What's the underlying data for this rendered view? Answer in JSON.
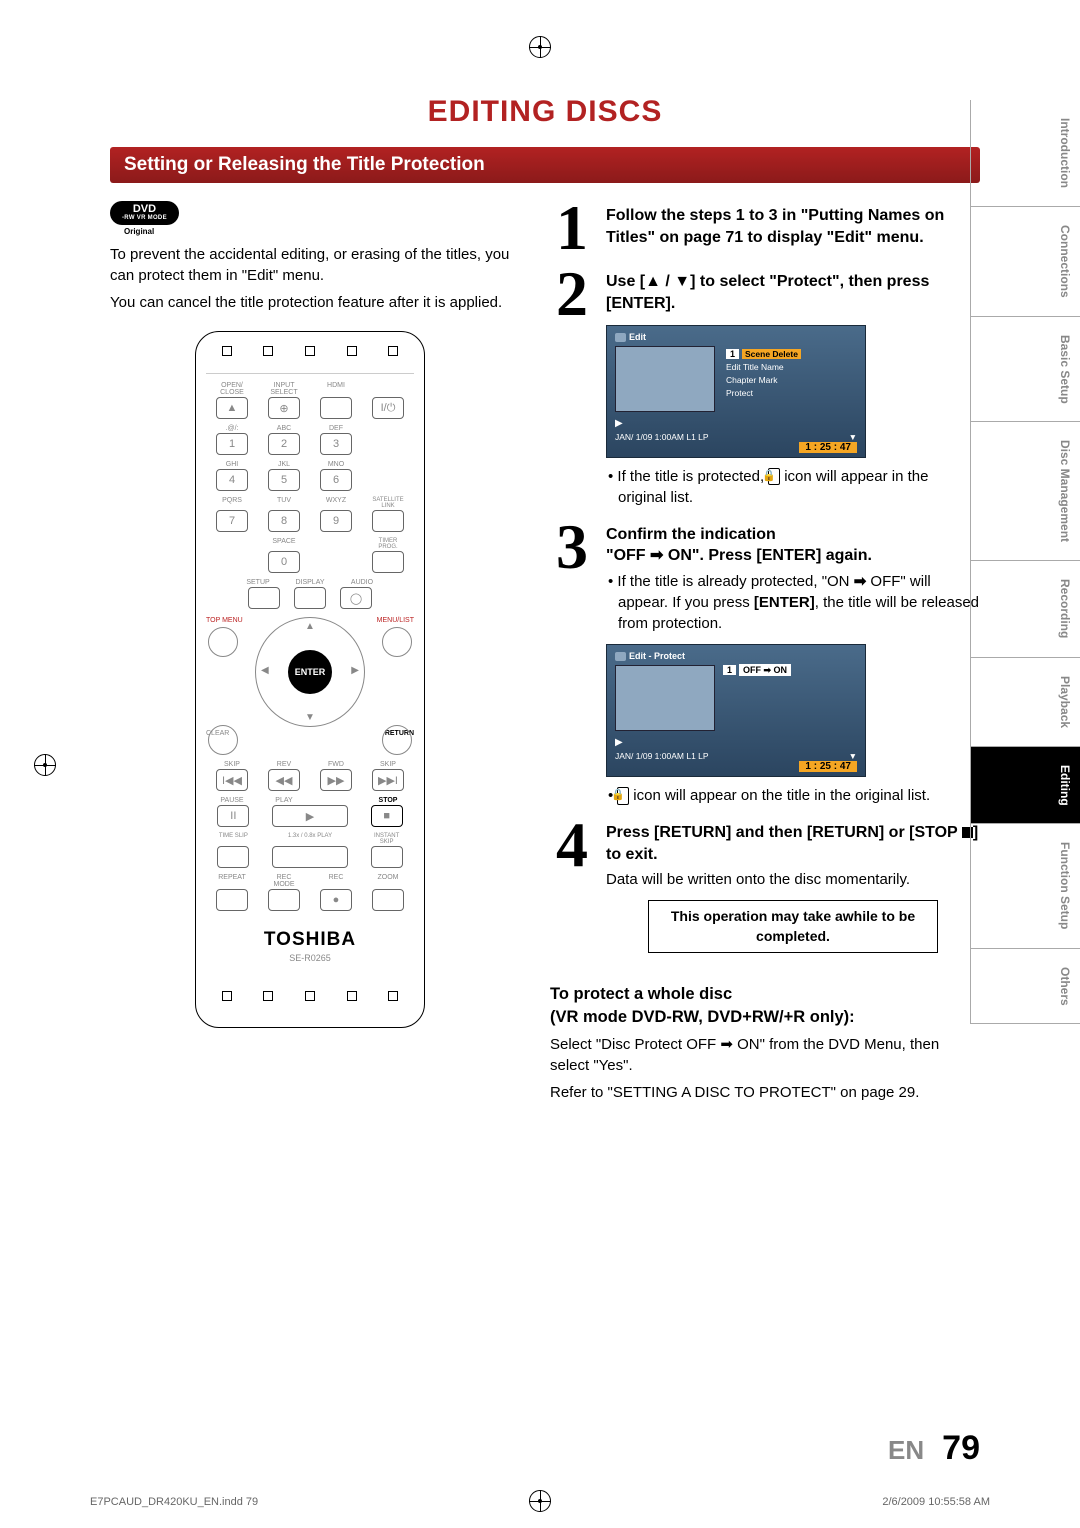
{
  "title": "EDITING DISCS",
  "section_bar": "Setting or Releasing the Title Protection",
  "dvd_badge": {
    "main": "DVD",
    "sub1": "-RW",
    "sub2": "VR MODE"
  },
  "original_label": "Original",
  "intro_p1": "To prevent the accidental editing, or erasing of the titles, you can protect them in \"Edit\" menu.",
  "intro_p2": "You can cancel the title protection feature after it is applied.",
  "remote": {
    "row1_labels": [
      "OPEN/\nCLOSE",
      "INPUT\nSELECT",
      "HDMI",
      ""
    ],
    "row2_labels": [
      ".@/:",
      "ABC",
      "DEF",
      ""
    ],
    "row3_labels": [
      "GHI",
      "JKL",
      "MNO",
      ""
    ],
    "row4_labels": [
      "PQRS",
      "TUV",
      "WXYZ",
      "SATELLITE\nLINK"
    ],
    "row5_labels": [
      "",
      "SPACE",
      "",
      "TIMER\nPROG."
    ],
    "row6_labels": [
      "SETUP",
      "DISPLAY",
      "AUDIO"
    ],
    "topmenu": "TOP MENU",
    "menulist": "MENU/LIST",
    "enter": "ENTER",
    "clear": "CLEAR",
    "return": "RETURN",
    "trans_labels": [
      "SKIP",
      "REV",
      "FWD",
      "SKIP"
    ],
    "trans2_labels": [
      "PAUSE",
      "PLAY",
      "",
      "STOP"
    ],
    "trans3_labels": [
      "TIME SLIP",
      "1.3x / 0.8x PLAY",
      "",
      "INSTANT SKIP"
    ],
    "rec_labels": [
      "REPEAT",
      "REC MODE",
      "REC",
      "ZOOM"
    ],
    "brand": "TOSHIBA",
    "model": "SE-R0265"
  },
  "steps": {
    "s1": {
      "num": "1",
      "bold": "Follow the steps 1 to 3 in \"Putting Names on Titles\" on page 71 to display \"Edit\" menu."
    },
    "s2": {
      "num": "2",
      "bold": "Use [▲ / ▼] to select \"Protect\", then press [ENTER].",
      "osd_header": "Edit",
      "osd_num": "1",
      "menu": [
        "Scene Delete",
        "Edit Title Name",
        "Chapter Mark",
        "Protect"
      ],
      "status": "JAN/ 1/09 1:00AM L1   LP",
      "time": "1 : 25 : 47",
      "bullet": "If the title is protected,  icon will appear in the original list."
    },
    "s3": {
      "num": "3",
      "bold_a": "Confirm the indication",
      "bold_b": "\"OFF ➡ ON\". Press [ENTER] again.",
      "bullet1": "If the title is already protected, \"ON ➡ OFF\" will appear. If you press [ENTER], the title will be released from protection.",
      "osd_header": "Edit - Protect",
      "osd_num": "1",
      "offon": "OFF ➡ ON",
      "status": "JAN/ 1/09 1:00AM L1   LP",
      "time": "1 : 25 : 47",
      "bullet2": " icon will appear on the title in the original list."
    },
    "s4": {
      "num": "4",
      "bold": "Press [RETURN] and then [RETURN] or [STOP ■] to exit.",
      "text": "Data will be written onto the disc momentarily.",
      "note": "This operation may take awhile to be completed."
    }
  },
  "protect_whole": {
    "head": "To protect a whole disc\n(VR mode DVD-RW, DVD+RW/+R only):",
    "p1": "Select \"Disc Protect OFF ➡ ON\" from the DVD Menu, then select \"Yes\".",
    "p2": "Refer to \"SETTING A DISC TO PROTECT\" on page 29."
  },
  "tabs": [
    "Introduction",
    "Connections",
    "Basic Setup",
    "Disc\nManagement",
    "Recording",
    "Playback",
    "Editing",
    "Function Setup",
    "Others"
  ],
  "footer": {
    "lang": "EN",
    "page": "79"
  },
  "meta": {
    "file": "E7PCAUD_DR420KU_EN.indd   79",
    "date": "2/6/2009   10:55:58 AM"
  }
}
